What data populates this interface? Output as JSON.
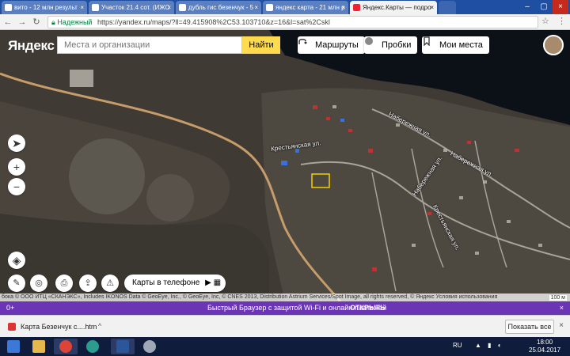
{
  "browser": {
    "tabs": [
      {
        "title": "вито - 12 млн результ",
        "active": false
      },
      {
        "title": "Участок 21.4 сот. (ИЖС",
        "active": false
      },
      {
        "title": "дубль гис безенчук - 5",
        "active": false
      },
      {
        "title": "яндекс карта - 21 млн р",
        "active": false
      },
      {
        "title": "Яндекс.Карты — подро",
        "active": true
      }
    ],
    "secure_label": "Надежный",
    "url": "https://yandex.ru/maps/?ll=49.415908%2C53.103710&z=16&l=sat%2Cskl"
  },
  "map": {
    "logo": "Яндекс",
    "search_placeholder": "Места и организации",
    "find_label": "Найти",
    "routes_label": "Маршруты",
    "traffic_label": "Пробки",
    "my_places_label": "Мои места",
    "phone_label": "Карты в телефоне",
    "streets": [
      "Крестьянская ул.",
      "Набережная ул.",
      "Набережная ул.",
      "Набережная ул.",
      "Крестьянская ул."
    ],
    "attribution": "бока © ООО ИТЦ «СКАНЭКС», Includes IKONOS Data © GeoEye, Inc., © GeoEye, Inc, © CNES 2013, Distribution Astrium Services/Spot Image, all rights reserved, © Яндекс Условия использования",
    "scale": "100 м"
  },
  "promo": {
    "left": "0+",
    "text": "Быстрый Браузер с защитой Wi-Fi и онлайн-платежей",
    "open_label": "ОТКРЫТЬ"
  },
  "downloads": {
    "item": "Карта Безенчук с....html",
    "show_all": "Показать все"
  },
  "taskbar": {
    "lang": "RU",
    "time": "18:00",
    "date": "25.04.2017"
  }
}
